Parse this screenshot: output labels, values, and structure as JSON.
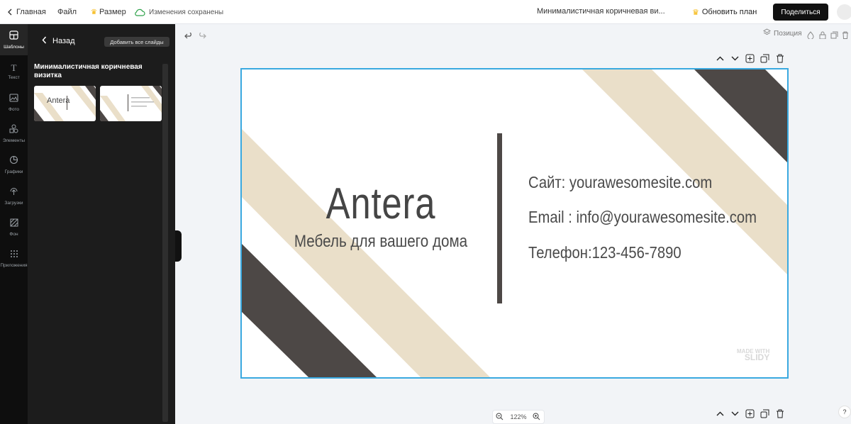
{
  "topbar": {
    "home_label": "Главная",
    "file_label": "Файл",
    "size_label": "Размер",
    "saved_label": "Изменения сохранены",
    "doc_title": "Минималистичная коричневая ви...",
    "upgrade_label": "Обновить план",
    "share_label": "Поделиться"
  },
  "rail": {
    "items": [
      {
        "label": "Шаблоны",
        "icon": "layout-icon"
      },
      {
        "label": "Текст",
        "icon": "text-icon"
      },
      {
        "label": "Фото",
        "icon": "image-icon"
      },
      {
        "label": "Элементы",
        "icon": "shapes-icon"
      },
      {
        "label": "Графики",
        "icon": "chart-icon"
      },
      {
        "label": "Загрузки",
        "icon": "upload-icon"
      },
      {
        "label": "Фон",
        "icon": "background-icon"
      },
      {
        "label": "Приложения",
        "icon": "apps-icon"
      }
    ]
  },
  "panel": {
    "back_label": "Назад",
    "add_all_label": "Добавить все слайды",
    "template_title": "Минималистичная коричневая визитка",
    "thumb_front_text": "Antera"
  },
  "canvas": {
    "position_label": "Позиция",
    "zoom_label": "122%"
  },
  "slide": {
    "brand": "Antera",
    "tagline": "Мебель для вашего дома",
    "site": "Сайт: yourawesomesite.com",
    "email": "Email : info@yourawesomesite.com",
    "phone": "Телефон:123-456-7890",
    "watermark_line1": "MADE WITH",
    "watermark_line2": "SLIDY",
    "colors": {
      "beige": "#eadfc9",
      "dark": "#4d4846",
      "accent_border": "#3aa9e0"
    }
  },
  "help_label": "?"
}
